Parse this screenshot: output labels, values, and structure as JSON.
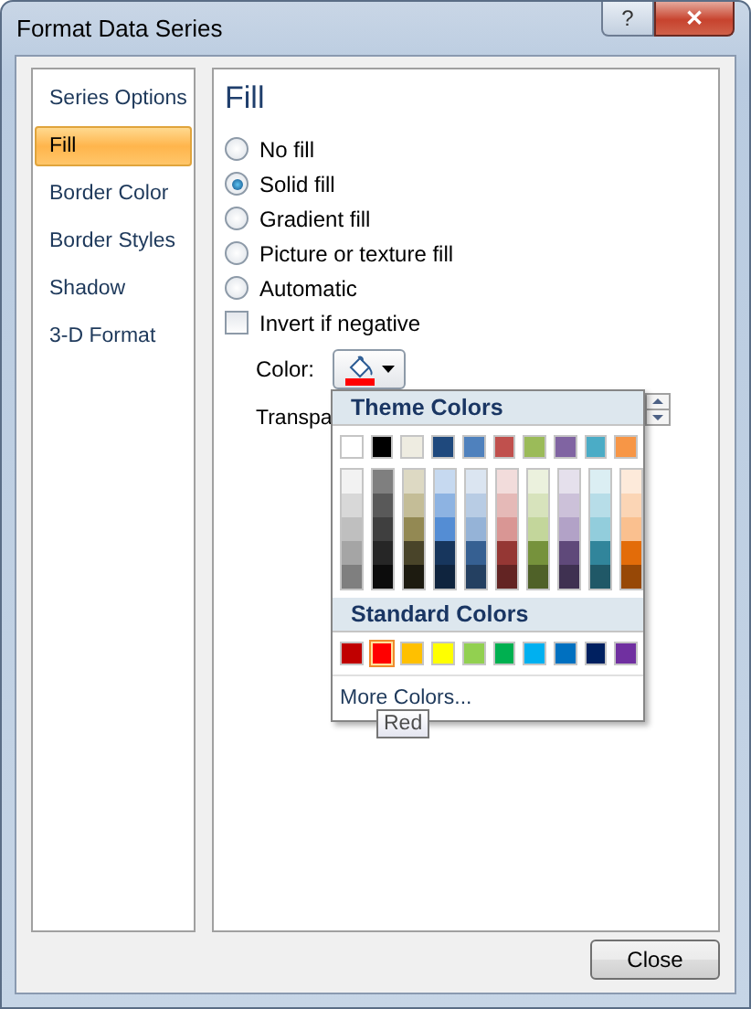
{
  "window": {
    "title": "Format Data Series",
    "help_button": "?",
    "close_button": "✕"
  },
  "sidebar": {
    "items": [
      {
        "label": "Series Options",
        "selected": false
      },
      {
        "label": "Fill",
        "selected": true
      },
      {
        "label": "Border Color",
        "selected": false
      },
      {
        "label": "Border Styles",
        "selected": false
      },
      {
        "label": "Shadow",
        "selected": false
      },
      {
        "label": "3-D Format",
        "selected": false
      }
    ]
  },
  "fill": {
    "heading": "Fill",
    "options": [
      {
        "label": "No fill",
        "selected": false
      },
      {
        "label": "Solid fill",
        "selected": true
      },
      {
        "label": "Gradient fill",
        "selected": false
      },
      {
        "label": "Picture or texture fill",
        "selected": false
      },
      {
        "label": "Automatic",
        "selected": false
      }
    ],
    "invert": {
      "label": "Invert if negative",
      "checked": false
    },
    "color_label": "Color:",
    "current_color": {
      "color": "#ff0000"
    },
    "transparency_label": "Transpa"
  },
  "color_menu": {
    "theme_header": "Theme Colors",
    "theme_colors": [
      {
        "color": "#ffffff",
        "shades": [
          {
            "color": "#f2f2f2"
          },
          {
            "color": "#d8d8d8"
          },
          {
            "color": "#bfbfbf"
          },
          {
            "color": "#a5a5a5"
          },
          {
            "color": "#7f7f7f"
          }
        ]
      },
      {
        "color": "#000000",
        "shades": [
          {
            "color": "#7f7f7f"
          },
          {
            "color": "#595959"
          },
          {
            "color": "#3f3f3f"
          },
          {
            "color": "#262626"
          },
          {
            "color": "#0c0c0c"
          }
        ]
      },
      {
        "color": "#eeece1",
        "shades": [
          {
            "color": "#ddd9c3"
          },
          {
            "color": "#c4bd97"
          },
          {
            "color": "#938953"
          },
          {
            "color": "#494429"
          },
          {
            "color": "#1d1b10"
          }
        ]
      },
      {
        "color": "#1f497d",
        "shades": [
          {
            "color": "#c6d9f0"
          },
          {
            "color": "#8db3e2"
          },
          {
            "color": "#548dd4"
          },
          {
            "color": "#17365d"
          },
          {
            "color": "#0f243e"
          }
        ]
      },
      {
        "color": "#4f81bd",
        "shades": [
          {
            "color": "#dbe5f1"
          },
          {
            "color": "#b8cce4"
          },
          {
            "color": "#95b3d7"
          },
          {
            "color": "#366092"
          },
          {
            "color": "#244061"
          }
        ]
      },
      {
        "color": "#c0504d",
        "shades": [
          {
            "color": "#f2dcdb"
          },
          {
            "color": "#e5b9b7"
          },
          {
            "color": "#d99694"
          },
          {
            "color": "#953734"
          },
          {
            "color": "#632423"
          }
        ]
      },
      {
        "color": "#9bbb59",
        "shades": [
          {
            "color": "#ebf1dd"
          },
          {
            "color": "#d7e3bc"
          },
          {
            "color": "#c3d69b"
          },
          {
            "color": "#76923c"
          },
          {
            "color": "#4f6128"
          }
        ]
      },
      {
        "color": "#8064a2",
        "shades": [
          {
            "color": "#e5e0ec"
          },
          {
            "color": "#ccc1d9"
          },
          {
            "color": "#b2a2c7"
          },
          {
            "color": "#5f497a"
          },
          {
            "color": "#3f3151"
          }
        ]
      },
      {
        "color": "#4bacc6",
        "shades": [
          {
            "color": "#dbeef3"
          },
          {
            "color": "#b7dde8"
          },
          {
            "color": "#92cddc"
          },
          {
            "color": "#31859b"
          },
          {
            "color": "#205867"
          }
        ]
      },
      {
        "color": "#f79646",
        "shades": [
          {
            "color": "#fdeada"
          },
          {
            "color": "#fbd5b5"
          },
          {
            "color": "#fac08f"
          },
          {
            "color": "#e36c09"
          },
          {
            "color": "#974806"
          }
        ]
      }
    ],
    "standard_header": "Standard Colors",
    "standard_colors": [
      {
        "color": "#c00000",
        "selected": false
      },
      {
        "color": "#ff0000",
        "selected": true
      },
      {
        "color": "#ffc000",
        "selected": false
      },
      {
        "color": "#ffff00",
        "selected": false
      },
      {
        "color": "#92d050",
        "selected": false
      },
      {
        "color": "#00b050",
        "selected": false
      },
      {
        "color": "#00b0f0",
        "selected": false
      },
      {
        "color": "#0070c0",
        "selected": false
      },
      {
        "color": "#002060",
        "selected": false
      },
      {
        "color": "#7030a0",
        "selected": false
      }
    ],
    "more_colors": "More Colors...",
    "tooltip": "Red"
  },
  "buttons": [
    "Close"
  ]
}
